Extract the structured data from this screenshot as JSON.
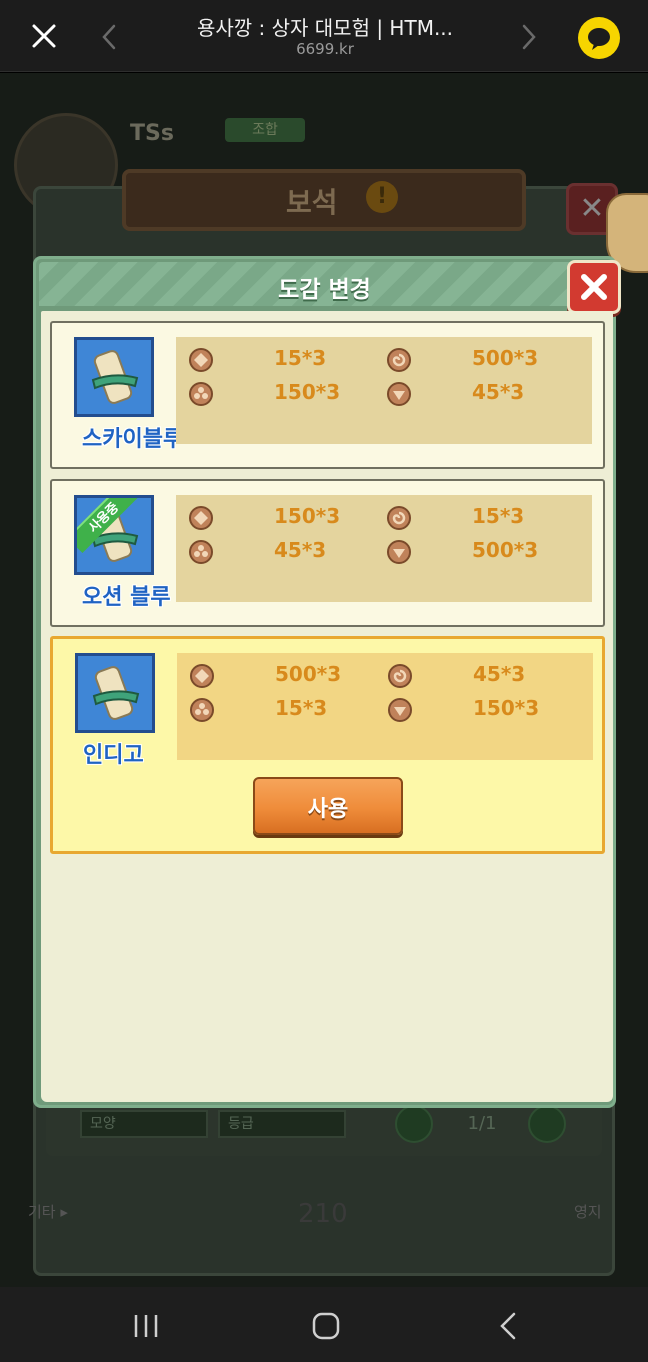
{
  "browser": {
    "title": "용사깡 : 상자 대모험 | HTM...",
    "url": "6699.kr",
    "icons": {
      "close": "close-icon",
      "back": "chevron-left-icon",
      "forward": "chevron-right-icon",
      "talk": "kakaotalk-icon"
    }
  },
  "background": {
    "player_prefix": "TSs",
    "rank_label": "조합",
    "gem_panel_title": "보석",
    "filter_shape": "모양",
    "filter_grade": "등급",
    "page_indicator": "1/1",
    "etc_label": "기타 ▸",
    "count": "210",
    "right_label": "영지"
  },
  "dialog": {
    "title": "도감 변경",
    "cards": [
      {
        "name": "스카이블루",
        "in_use": false,
        "selected": false,
        "stats": {
          "diamond": "15*3",
          "swirl": "500*3",
          "flower": "150*3",
          "gem": "45*3"
        }
      },
      {
        "name": "오션 블루",
        "in_use": true,
        "in_use_label": "사용중",
        "selected": false,
        "stats": {
          "diamond": "150*3",
          "swirl": "15*3",
          "flower": "45*3",
          "gem": "500*3"
        }
      },
      {
        "name": "인디고",
        "in_use": false,
        "selected": true,
        "use_button": "사용",
        "stats": {
          "diamond": "500*3",
          "swirl": "45*3",
          "flower": "15*3",
          "gem": "150*3"
        }
      }
    ]
  },
  "colors": {
    "accent_orange": "#ef8c3a",
    "name_blue": "#1f63c3",
    "stat_orange": "#d88a1c",
    "header_green": "#7aa888"
  }
}
